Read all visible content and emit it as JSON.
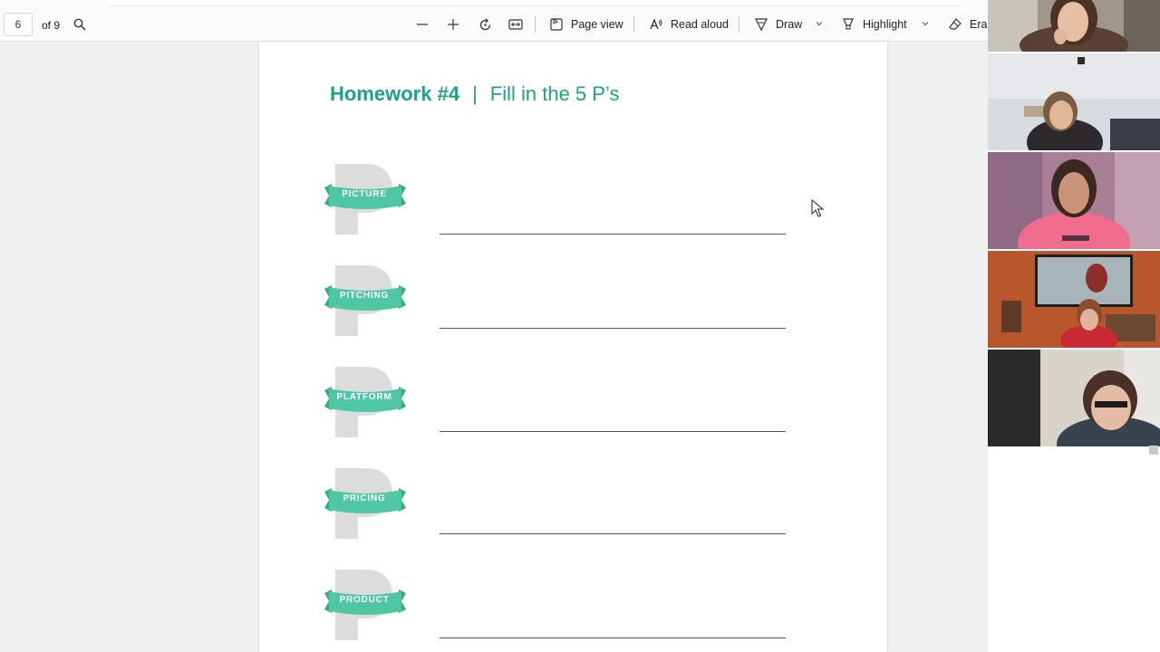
{
  "toolbar": {
    "page_number": "6",
    "page_total": "of 9",
    "page_view": "Page view",
    "read_aloud": "Read aloud",
    "draw": "Draw",
    "highlight": "Highlight",
    "erase": "Eras"
  },
  "document": {
    "title_bold": "Homework #4",
    "title_sep": "|",
    "title_rest": "Fill in the 5 P’s",
    "items": [
      {
        "label": "PICTURE"
      },
      {
        "label": "PITCHING"
      },
      {
        "label": "PLATFORM"
      },
      {
        "label": "PRICING"
      },
      {
        "label": "PRODUCT"
      }
    ]
  },
  "colors": {
    "accent": "#1ba386",
    "ribbon": "#4fc7a2",
    "p_letter": "#dcdcdc"
  }
}
